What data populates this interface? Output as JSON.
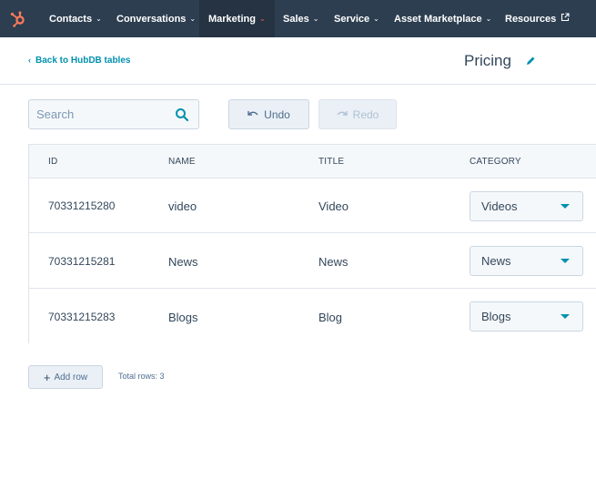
{
  "topnav": {
    "logo_icon": "hubspot-sprocket-icon",
    "brand_color": "#ff7a59",
    "items": [
      {
        "label": "Contacts"
      },
      {
        "label": "Conversations"
      },
      {
        "label": "Marketing"
      },
      {
        "label": "Sales"
      },
      {
        "label": "Service"
      },
      {
        "label": "Asset Marketplace"
      },
      {
        "label": "Resources"
      }
    ],
    "active_item": "Marketing"
  },
  "header": {
    "back_label": "Back to HubDB tables",
    "title": "Pricing",
    "edit_icon": "pencil-icon"
  },
  "toolbar": {
    "search_placeholder": "Search",
    "search_icon": "search-icon",
    "undo_label": "Undo",
    "redo_label": "Redo"
  },
  "table": {
    "columns": [
      "ID",
      "NAME",
      "TITLE",
      "CATEGORY"
    ],
    "rows": [
      {
        "id": "70331215280",
        "name": "video",
        "title": "Video",
        "category": "Videos"
      },
      {
        "id": "70331215281",
        "name": "News",
        "title": "News",
        "category": "News"
      },
      {
        "id": "70331215283",
        "name": "Blogs",
        "title": "Blog",
        "category": "Blogs"
      }
    ]
  },
  "footer": {
    "add_row_label": "Add row",
    "total_rows_label": "Total rows: 3"
  },
  "colors": {
    "nav_bg": "#2d3e50",
    "link": "#0091ae",
    "active_chevron": "#f2545b"
  }
}
